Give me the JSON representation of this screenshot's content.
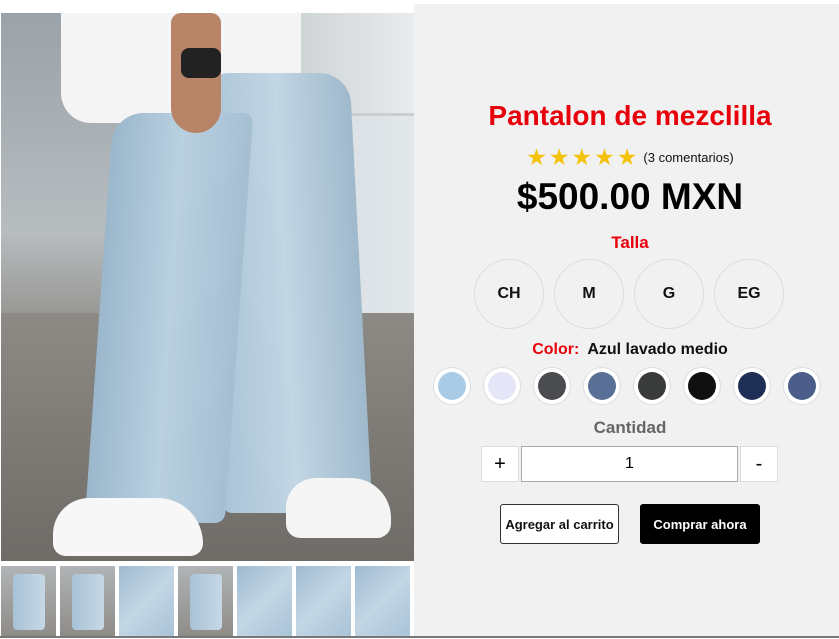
{
  "product": {
    "title": "Pantalon de mezclilla",
    "rating_stars": 5,
    "reviews": "(3 comentarios)",
    "price": "$500.00 MXN"
  },
  "size": {
    "label": "Talla",
    "options": [
      "CH",
      "M",
      "G",
      "EG"
    ]
  },
  "color": {
    "label": "Color:",
    "selected": "Azul lavado medio",
    "swatches": [
      "#a9cbe6",
      "#e4e6f7",
      "#4a4c50",
      "#5a6f96",
      "#3a3c3b",
      "#101010",
      "#1f2f55",
      "#4c5d8a"
    ]
  },
  "quantity": {
    "label": "Cantidad",
    "value": "1",
    "plus": "+",
    "minus": "-"
  },
  "buttons": {
    "add_to_cart": "Agregar al carrito",
    "buy_now": "Comprar ahora"
  }
}
